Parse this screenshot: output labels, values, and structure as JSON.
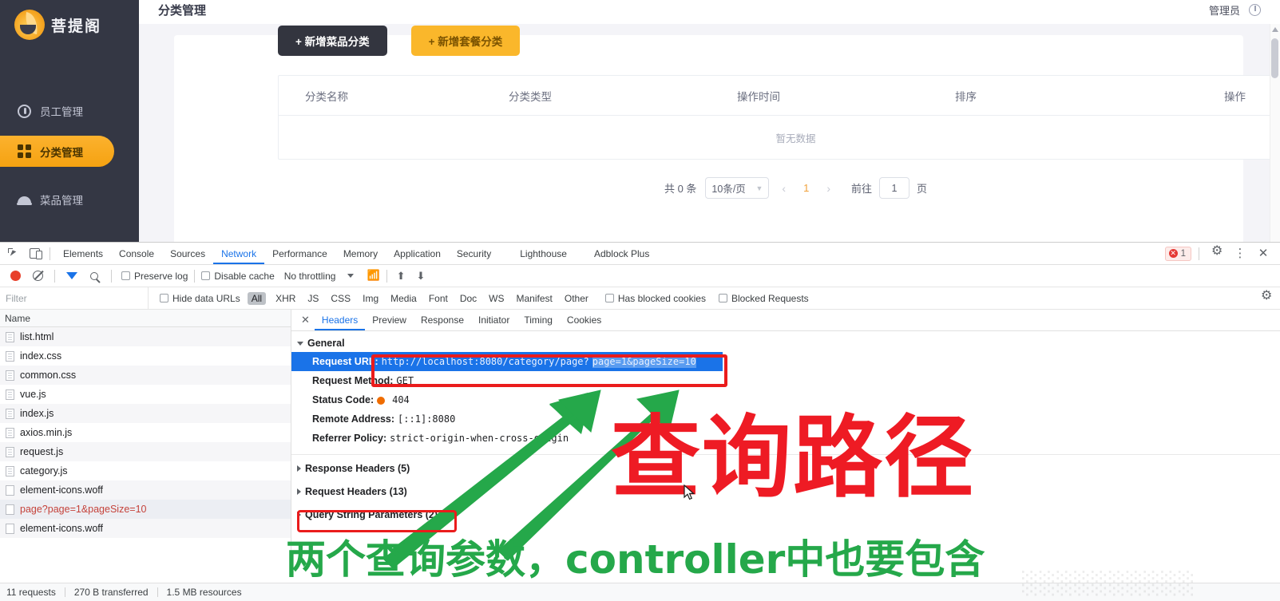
{
  "app": {
    "logo_text": "菩提阁",
    "page_title": "分类管理",
    "admin_label": "管理员",
    "sidebar": [
      {
        "label": "员工管理",
        "icon": "user-icon",
        "active": false
      },
      {
        "label": "分类管理",
        "icon": "grid-icon",
        "active": true
      },
      {
        "label": "菜品管理",
        "icon": "dish-cover-icon",
        "active": false
      }
    ],
    "buttons": {
      "add_dish_category": "+ 新增菜品分类",
      "add_combo_category": "+ 新增套餐分类"
    },
    "table": {
      "columns": [
        "分类名称",
        "分类类型",
        "操作时间",
        "排序",
        "操作"
      ],
      "empty_text": "暂无数据",
      "rows": []
    },
    "pagination": {
      "total_text": "共 0 条",
      "page_size": "10条/页",
      "prev": "‹",
      "current_page": "1",
      "next": "›",
      "goto_label": "前往",
      "goto_value": "1",
      "page_unit": "页"
    },
    "colors": {
      "accent": "#fab72b",
      "sidebar_bg": "#343744",
      "dark_button": "#33353f"
    }
  },
  "devtools": {
    "panel_tabs": [
      {
        "label": "Elements",
        "active": false
      },
      {
        "label": "Console",
        "active": false
      },
      {
        "label": "Sources",
        "active": false
      },
      {
        "label": "Network",
        "active": true
      },
      {
        "label": "Performance",
        "active": false
      },
      {
        "label": "Memory",
        "active": false
      },
      {
        "label": "Application",
        "active": false
      },
      {
        "label": "Security",
        "active": false
      },
      {
        "label": "Lighthouse",
        "active": false
      },
      {
        "label": "Adblock Plus",
        "active": false
      }
    ],
    "error_count": "1",
    "toolbar": {
      "preserve_log": "Preserve log",
      "disable_cache": "Disable cache",
      "throttling": "No throttling"
    },
    "filterbar": {
      "filter_placeholder": "Filter",
      "hide_data_urls": "Hide data URLs",
      "types": [
        "All",
        "XHR",
        "JS",
        "CSS",
        "Img",
        "Media",
        "Font",
        "Doc",
        "WS",
        "Manifest",
        "Other"
      ],
      "selected_type": "All",
      "has_blocked_cookies": "Has blocked cookies",
      "blocked_requests": "Blocked Requests"
    },
    "request_list": {
      "column_header": "Name",
      "items": [
        {
          "name": "list.html",
          "icon": "document-icon",
          "selected": false
        },
        {
          "name": "index.css",
          "icon": "document-icon",
          "selected": false
        },
        {
          "name": "common.css",
          "icon": "document-icon",
          "selected": false
        },
        {
          "name": "vue.js",
          "icon": "document-icon",
          "selected": false
        },
        {
          "name": "index.js",
          "icon": "document-icon",
          "selected": false
        },
        {
          "name": "axios.min.js",
          "icon": "document-icon",
          "selected": false
        },
        {
          "name": "request.js",
          "icon": "document-icon",
          "selected": false
        },
        {
          "name": "category.js",
          "icon": "document-icon",
          "selected": false
        },
        {
          "name": "element-icons.woff",
          "icon": "font-icon",
          "selected": false
        },
        {
          "name": "page?page=1&pageSize=10",
          "icon": "font-icon",
          "selected": true
        },
        {
          "name": "element-icons.woff",
          "icon": "font-icon",
          "selected": false
        }
      ]
    },
    "detail_tabs": [
      {
        "label": "Headers",
        "active": true
      },
      {
        "label": "Preview",
        "active": false
      },
      {
        "label": "Response",
        "active": false
      },
      {
        "label": "Initiator",
        "active": false
      },
      {
        "label": "Timing",
        "active": false
      },
      {
        "label": "Cookies",
        "active": false
      }
    ],
    "headers": {
      "general_label": "General",
      "request_url_key": "Request URL",
      "request_url_base": "http://localhost:8080/category/page?",
      "request_url_query": "page=1&pageSize=10",
      "request_method_key": "Request Method",
      "request_method_value": "GET",
      "status_code_key": "Status Code",
      "status_code_value": "404",
      "remote_address_key": "Remote Address",
      "remote_address_value": "[::1]:8080",
      "referrer_policy_key": "Referrer Policy",
      "referrer_policy_value": "strict-origin-when-cross-origin",
      "response_headers": "Response Headers (5)",
      "request_headers": "Request Headers (13)",
      "query_string_parameters": "Query String Parameters (2)"
    },
    "status_bar": {
      "requests": "11 requests",
      "transferred": "270 B transferred",
      "resources": "1.5 MB resources"
    }
  },
  "annotations": {
    "title_red": "查询路径",
    "bottom_green": "两个查询参数，controller中也要包含",
    "red_color": "#ee1b24",
    "green_color": "#25a84a"
  }
}
